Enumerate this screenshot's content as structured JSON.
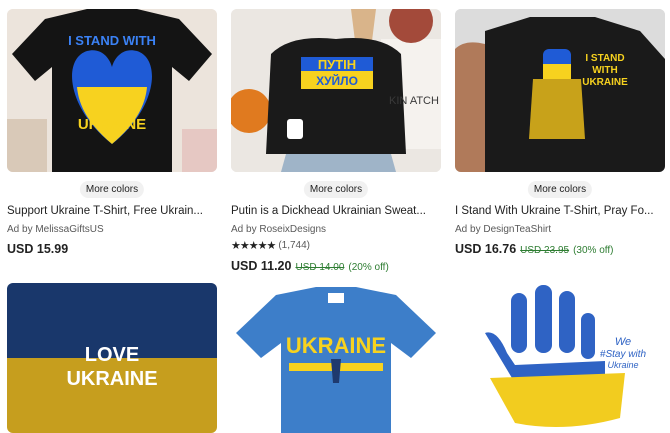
{
  "listings": [
    {
      "more_colors": "More colors",
      "title": "Support Ukraine T-Shirt, Free Ukrain...",
      "seller": "Ad by MelissaGiftsUS",
      "price": "USD 15.99",
      "image": {
        "line1": "I STAND WITH",
        "line2": "UKRAINE"
      }
    },
    {
      "more_colors": "More colors",
      "title": "Putin is a Dickhead Ukrainian Sweat...",
      "seller": "Ad by RoseixDesigns",
      "rating_stars": "★★★★★",
      "rating_count": "(1,744)",
      "price": "USD 11.20",
      "original_price": "USD 14.00",
      "discount": "(20% off)",
      "image": {
        "line1": "ПУТІН",
        "line2": "ХУЙЛО",
        "pillow": "KIN ATCH"
      }
    },
    {
      "more_colors": "More colors",
      "title": "I Stand With Ukraine T-Shirt, Pray Fo...",
      "seller": "Ad by DesignTeaShirt",
      "price": "USD 16.76",
      "original_price": "USD 23.95",
      "discount": "(30% off)",
      "image": {
        "line1": "I STAND",
        "line2": "WITH",
        "line3": "UKRAINE"
      }
    }
  ],
  "row2": [
    {
      "line1": "LOVE",
      "line2": "UKRAINE"
    },
    {
      "line1": "UKRAINE"
    },
    {
      "line1": "We",
      "line2": "#Stay with",
      "line3": "Ukraine"
    }
  ],
  "colors": {
    "ukraine_blue": "#1f5bd6",
    "ukraine_yellow": "#f7d21f",
    "discount_green": "#2e7d32",
    "shirt_black": "#141414",
    "shirt_blue": "#3d7ec9"
  }
}
